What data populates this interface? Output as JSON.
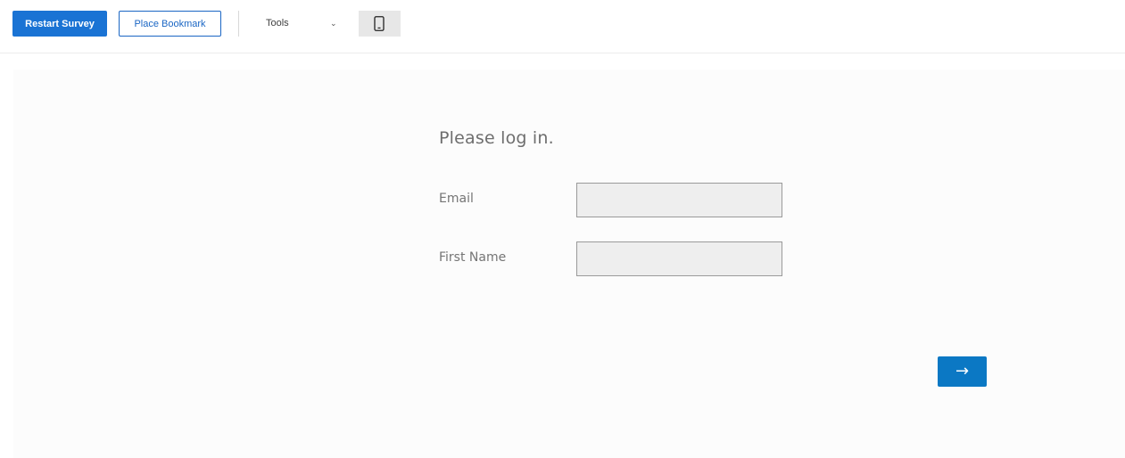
{
  "toolbar": {
    "restart_label": "Restart Survey",
    "bookmark_label": "Place Bookmark",
    "tools_label": "Tools",
    "tools_chevron": "⌄",
    "device_icon": "mobile-phone-icon"
  },
  "survey": {
    "heading": "Please log in.",
    "fields": [
      {
        "label": "Email",
        "value": ""
      },
      {
        "label": "First Name",
        "value": ""
      }
    ],
    "next_label": "→"
  },
  "colors": {
    "primary": "#1a73d4",
    "next_button": "#0b78c4",
    "field_bg": "#eeeeee",
    "survey_bg": "#fcfcfc"
  }
}
